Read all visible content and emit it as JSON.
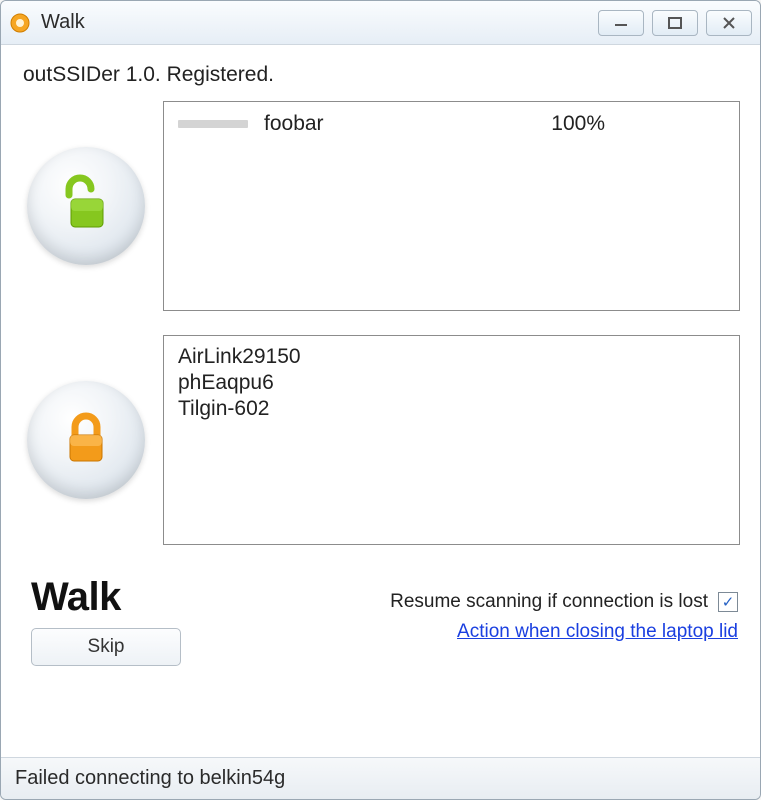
{
  "window": {
    "title": "Walk"
  },
  "registration": "outSSIDer 1.0. Registered.",
  "open_networks": [
    {
      "name": "foobar",
      "signal_pct": "100%"
    }
  ],
  "secured_networks": [
    "AirLink29150",
    "phEaqpu6",
    "Tilgin-602"
  ],
  "action_label": "Walk",
  "skip_label": "Skip",
  "resume_label": "Resume scanning if connection is lost",
  "resume_checked": true,
  "lid_link": "Action when closing the laptop lid",
  "status": "Failed connecting to belkin54g",
  "colors": {
    "open_lock": "#86c71f",
    "secured_lock": "#f39b1a",
    "link": "#1a3fe0"
  }
}
